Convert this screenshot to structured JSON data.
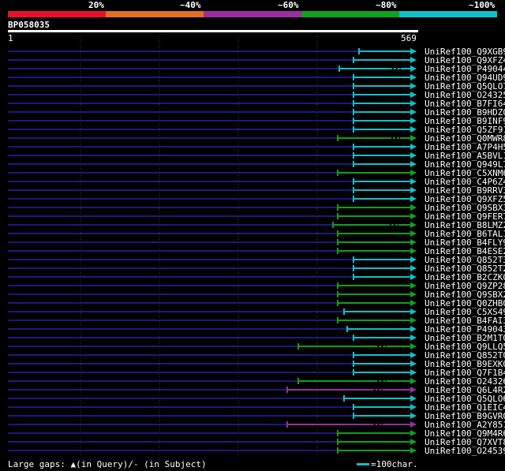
{
  "legend": {
    "labels": [
      "20%",
      "~40%",
      "~60%",
      "~80%",
      "~100%"
    ],
    "colors": [
      "#e8102a",
      "#e07020",
      "#9a2ea0",
      "#10a020",
      "#10c0c8"
    ]
  },
  "query_id": "BP058035",
  "ruler": {
    "start": "1",
    "end": "569"
  },
  "hits": [
    {
      "label": "UniRef100_Q9XGB9",
      "tier": 4,
      "start": 455,
      "gap": false
    },
    {
      "label": "UniRef100_Q9XFZ4",
      "tier": 4,
      "start": 448,
      "gap": false
    },
    {
      "label": "UniRef100_P49044",
      "tier": 4,
      "start": 430,
      "gap": true
    },
    {
      "label": "UniRef100_Q94UD9",
      "tier": 4,
      "start": 448,
      "gap": false
    },
    {
      "label": "UniRef100_Q5QLO7",
      "tier": 4,
      "start": 448,
      "gap": false
    },
    {
      "label": "UniRef100_O24325",
      "tier": 4,
      "start": 448,
      "gap": false
    },
    {
      "label": "UniRef100_B7FI64",
      "tier": 4,
      "start": 448,
      "gap": false
    },
    {
      "label": "UniRef100_B9HDZ0",
      "tier": 4,
      "start": 448,
      "gap": false
    },
    {
      "label": "UniRef100_B9INF9",
      "tier": 4,
      "start": 448,
      "gap": false
    },
    {
      "label": "UniRef100_Q5ZF91",
      "tier": 4,
      "start": 448,
      "gap": false
    },
    {
      "label": "UniRef100_Q0MWR8",
      "tier": 3,
      "start": 428,
      "gap": true
    },
    {
      "label": "UniRef100_A7P4H5",
      "tier": 4,
      "start": 448,
      "gap": false
    },
    {
      "label": "UniRef100_A5BVL1",
      "tier": 4,
      "start": 448,
      "gap": false
    },
    {
      "label": "UniRef100_Q949L7",
      "tier": 4,
      "start": 448,
      "gap": false
    },
    {
      "label": "UniRef100_C5XNM6",
      "tier": 3,
      "start": 428,
      "gap": false
    },
    {
      "label": "UniRef100_C4P6Z4",
      "tier": 4,
      "start": 448,
      "gap": false
    },
    {
      "label": "UniRef100_B9RRV3",
      "tier": 4,
      "start": 448,
      "gap": false
    },
    {
      "label": "UniRef100_Q9XFZ5",
      "tier": 4,
      "start": 448,
      "gap": false
    },
    {
      "label": "UniRef100_Q9SBX3",
      "tier": 3,
      "start": 428,
      "gap": false
    },
    {
      "label": "UniRef100_Q9FER7",
      "tier": 3,
      "start": 428,
      "gap": false
    },
    {
      "label": "UniRef100_B8LMZ2",
      "tier": 3,
      "start": 422,
      "gap": true
    },
    {
      "label": "UniRef100_B6TAL1",
      "tier": 3,
      "start": 428,
      "gap": false
    },
    {
      "label": "UniRef100_B4FLY9",
      "tier": 3,
      "start": 428,
      "gap": false
    },
    {
      "label": "UniRef100_B4ESE2",
      "tier": 3,
      "start": 428,
      "gap": false
    },
    {
      "label": "UniRef100_Q852T3",
      "tier": 4,
      "start": 448,
      "gap": false
    },
    {
      "label": "UniRef100_Q852T2",
      "tier": 4,
      "start": 448,
      "gap": false
    },
    {
      "label": "UniRef100_B2CZK0",
      "tier": 4,
      "start": 448,
      "gap": false
    },
    {
      "label": "UniRef100_Q9ZP28",
      "tier": 3,
      "start": 428,
      "gap": false
    },
    {
      "label": "UniRef100_Q9SBX2",
      "tier": 3,
      "start": 428,
      "gap": false
    },
    {
      "label": "UniRef100_Q0ZHB0",
      "tier": 3,
      "start": 428,
      "gap": false
    },
    {
      "label": "UniRef100_C5XS49",
      "tier": 4,
      "start": 436,
      "gap": false
    },
    {
      "label": "UniRef100_B4FAI3",
      "tier": 3,
      "start": 428,
      "gap": false
    },
    {
      "label": "UniRef100_P49043",
      "tier": 4,
      "start": 440,
      "gap": false
    },
    {
      "label": "UniRef100_B2M1T0",
      "tier": 4,
      "start": 448,
      "gap": false
    },
    {
      "label": "UniRef100_Q9LLQ5",
      "tier": 3,
      "start": 378,
      "gap": true
    },
    {
      "label": "UniRef100_Q852T0",
      "tier": 4,
      "start": 448,
      "gap": false
    },
    {
      "label": "UniRef100_B9EXK0",
      "tier": 4,
      "start": 448,
      "gap": false
    },
    {
      "label": "UniRef100_Q7F1B4",
      "tier": 4,
      "start": 448,
      "gap": false
    },
    {
      "label": "UniRef100_O24326",
      "tier": 3,
      "start": 378,
      "gap": true
    },
    {
      "label": "UniRef100_Q6L4R2",
      "tier": 2,
      "start": 364,
      "gap": true
    },
    {
      "label": "UniRef100_Q5QLO6",
      "tier": 4,
      "start": 436,
      "gap": false
    },
    {
      "label": "UniRef100_Q1EIC4",
      "tier": 4,
      "start": 448,
      "gap": false
    },
    {
      "label": "UniRef100_B9GVR0",
      "tier": 4,
      "start": 448,
      "gap": false
    },
    {
      "label": "UniRef100_A2Y851",
      "tier": 2,
      "start": 364,
      "gap": true
    },
    {
      "label": "UniRef100_Q9M4R6",
      "tier": 3,
      "start": 428,
      "gap": false
    },
    {
      "label": "UniRef100_Q7XVT8",
      "tier": 3,
      "start": 428,
      "gap": false
    },
    {
      "label": "UniRef100_O24539",
      "tier": 3,
      "start": 428,
      "gap": false
    }
  ],
  "footer": {
    "gaps_text": "Large gaps: ▲(in Query)/- (in Subject)",
    "scale_text": "=100char."
  }
}
